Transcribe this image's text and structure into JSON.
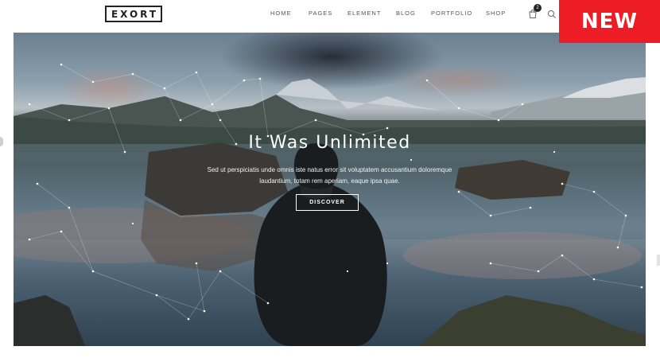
{
  "header": {
    "logo": "EXORT",
    "nav": [
      "HOME",
      "PAGES",
      "ELEMENT",
      "BLOG",
      "PORTFOLIO",
      "SHOP"
    ],
    "cart_count": "2",
    "icons": [
      "cart-icon",
      "search-icon"
    ]
  },
  "badge": {
    "label": "NEW",
    "color": "#ee1c24"
  },
  "hero": {
    "title": "It Was Unlimited",
    "text_line1": "Sed ut perspiciatis unde omnis iste natus error sit voluptatem accusantium doloremque",
    "text_line2": "laudantium, totam rem aperiam, eaque ipsa quae.",
    "button_label": "DISCOVER"
  }
}
